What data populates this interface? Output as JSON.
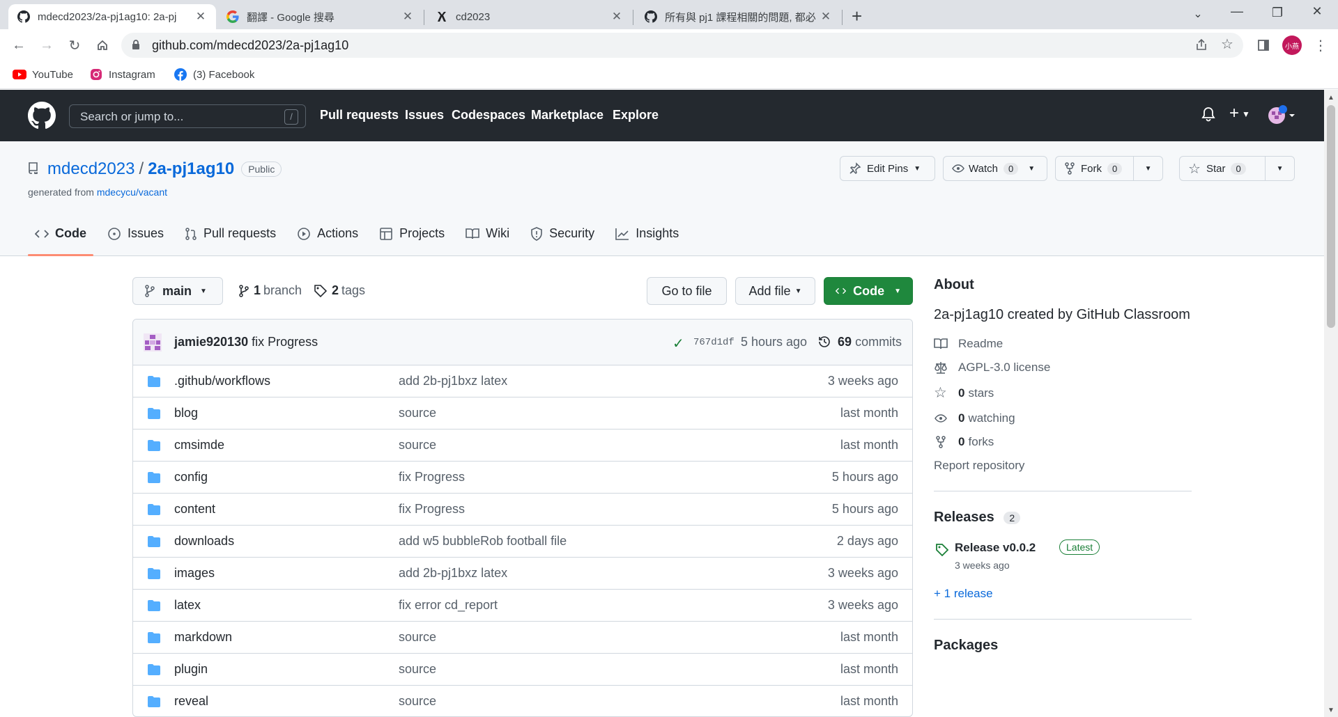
{
  "browser": {
    "tabs": [
      {
        "title": "mdecd2023/2a-pj1ag10: 2a-pj",
        "favicon": "github-icon",
        "active": true
      },
      {
        "title": "翻譯 - Google 搜尋",
        "favicon": "google-icon",
        "active": false
      },
      {
        "title": "cd2023",
        "favicon": "site-icon",
        "active": false
      },
      {
        "title": "所有與 pj1 課程相關的問題, 都必",
        "favicon": "github-icon",
        "active": false
      }
    ],
    "url": "github.com/mdecd2023/2a-pj1ag10",
    "profile_label": "小燕",
    "bookmarks": [
      {
        "label": "YouTube",
        "icon": "youtube-icon"
      },
      {
        "label": "Instagram",
        "icon": "instagram-icon"
      },
      {
        "label": "(3) Facebook",
        "icon": "facebook-icon"
      }
    ]
  },
  "github": {
    "search_placeholder": "Search or jump to...",
    "search_key": "/",
    "nav": [
      "Pull requests",
      "Issues",
      "Codespaces",
      "Marketplace",
      "Explore"
    ]
  },
  "repo": {
    "owner": "mdecd2023",
    "name": "2a-pj1ag10",
    "visibility": "Public",
    "generated_prefix": "generated from",
    "generated_from": "mdecycu/vacant",
    "actions": {
      "edit_pins": "Edit Pins",
      "watch": "Watch",
      "watch_count": "0",
      "fork": "Fork",
      "fork_count": "0",
      "star": "Star",
      "star_count": "0"
    },
    "tabs": [
      "Code",
      "Issues",
      "Pull requests",
      "Actions",
      "Projects",
      "Wiki",
      "Security",
      "Insights"
    ],
    "branch": "main",
    "branch_count": "1",
    "branch_label": "branch",
    "tag_count": "2",
    "tag_label": "tags",
    "go_to_file": "Go to file",
    "add_file": "Add file",
    "code_button": "Code",
    "latest_commit": {
      "author": "jamie920130",
      "message": "fix Progress",
      "sha": "767d1df",
      "time": "5 hours ago",
      "commit_count": "69",
      "commit_label": "commits"
    },
    "files": [
      {
        "name": ".github/workflows",
        "message": "add 2b-pj1bxz latex",
        "age": "3 weeks ago"
      },
      {
        "name": "blog",
        "message": "source",
        "age": "last month"
      },
      {
        "name": "cmsimde",
        "message": "source",
        "age": "last month"
      },
      {
        "name": "config",
        "message": "fix Progress",
        "age": "5 hours ago"
      },
      {
        "name": "content",
        "message": "fix Progress",
        "age": "5 hours ago"
      },
      {
        "name": "downloads",
        "message": "add w5 bubbleRob football file",
        "age": "2 days ago"
      },
      {
        "name": "images",
        "message": "add 2b-pj1bxz latex",
        "age": "3 weeks ago"
      },
      {
        "name": "latex",
        "message": "fix error cd_report",
        "age": "3 weeks ago"
      },
      {
        "name": "markdown",
        "message": "source",
        "age": "last month"
      },
      {
        "name": "plugin",
        "message": "source",
        "age": "last month"
      },
      {
        "name": "reveal",
        "message": "source",
        "age": "last month"
      }
    ]
  },
  "sidebar": {
    "about_title": "About",
    "description": "2a-pj1ag10 created by GitHub Classroom",
    "readme": "Readme",
    "license": "AGPL-3.0 license",
    "stars_count": "0",
    "stars_label": "stars",
    "watching_count": "0",
    "watching_label": "watching",
    "forks_count": "0",
    "forks_label": "forks",
    "report": "Report repository",
    "releases_title": "Releases",
    "releases_count": "2",
    "release_name": "Release v0.0.2",
    "release_badge": "Latest",
    "release_date": "3 weeks ago",
    "more_releases": "+ 1 release",
    "packages_title": "Packages"
  }
}
